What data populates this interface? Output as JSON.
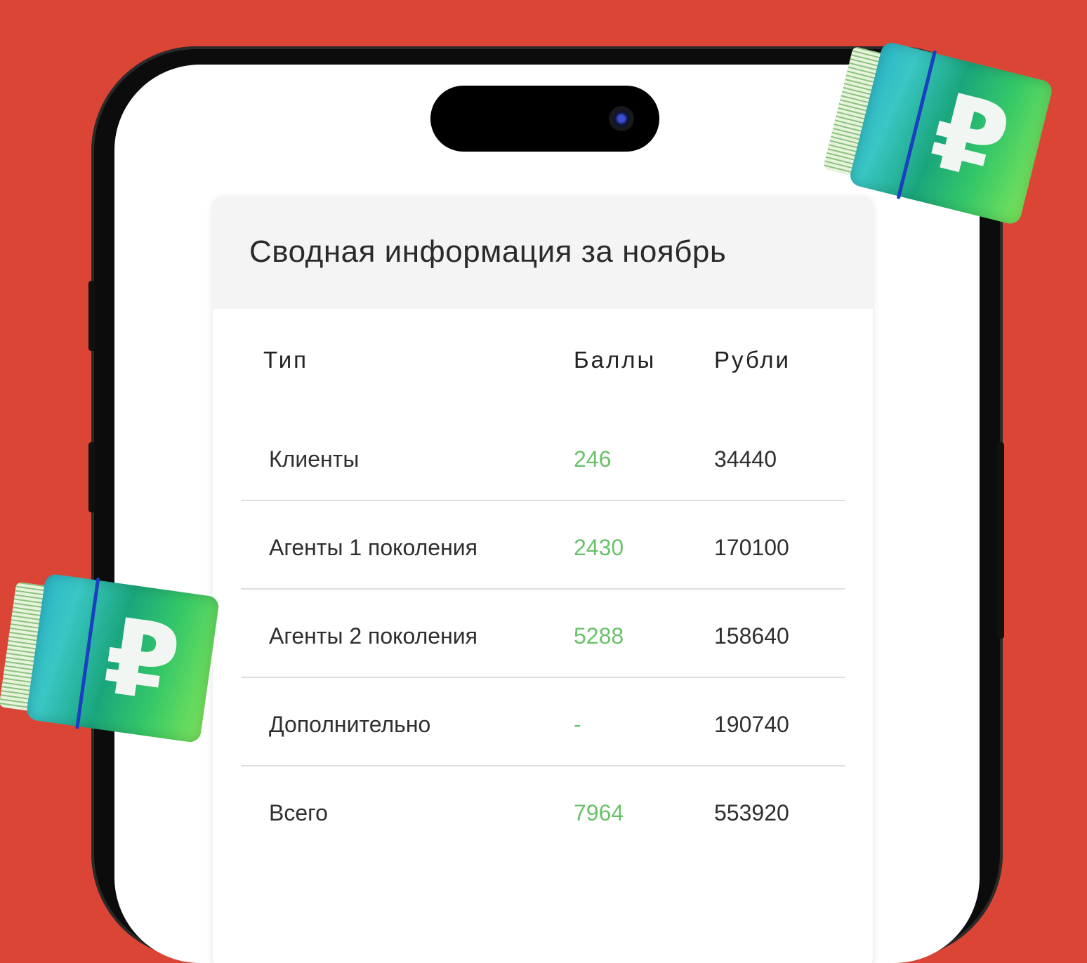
{
  "summary": {
    "title": "Сводная информация за ноябрь",
    "columns": {
      "type": "Тип",
      "points": "Баллы",
      "rubles": "Рубли"
    },
    "rows": [
      {
        "type": "Клиенты",
        "points": "246",
        "rubles": "34440"
      },
      {
        "type": "Агенты 1 поколения",
        "points": "2430",
        "rubles": "170100"
      },
      {
        "type": "Агенты 2 поколения",
        "points": "5288",
        "rubles": "158640"
      },
      {
        "type": "Дополнительно",
        "points": "-",
        "rubles": "190740"
      },
      {
        "type": "Всего",
        "points": "7964",
        "rubles": "553920"
      }
    ]
  },
  "decor": {
    "currency_symbol": "₽",
    "currency_icon": "ruble-banknote-stack-icon"
  },
  "colors": {
    "background": "#db4535",
    "points_text": "#69c26a",
    "header_bg": "#f4f4f4"
  }
}
